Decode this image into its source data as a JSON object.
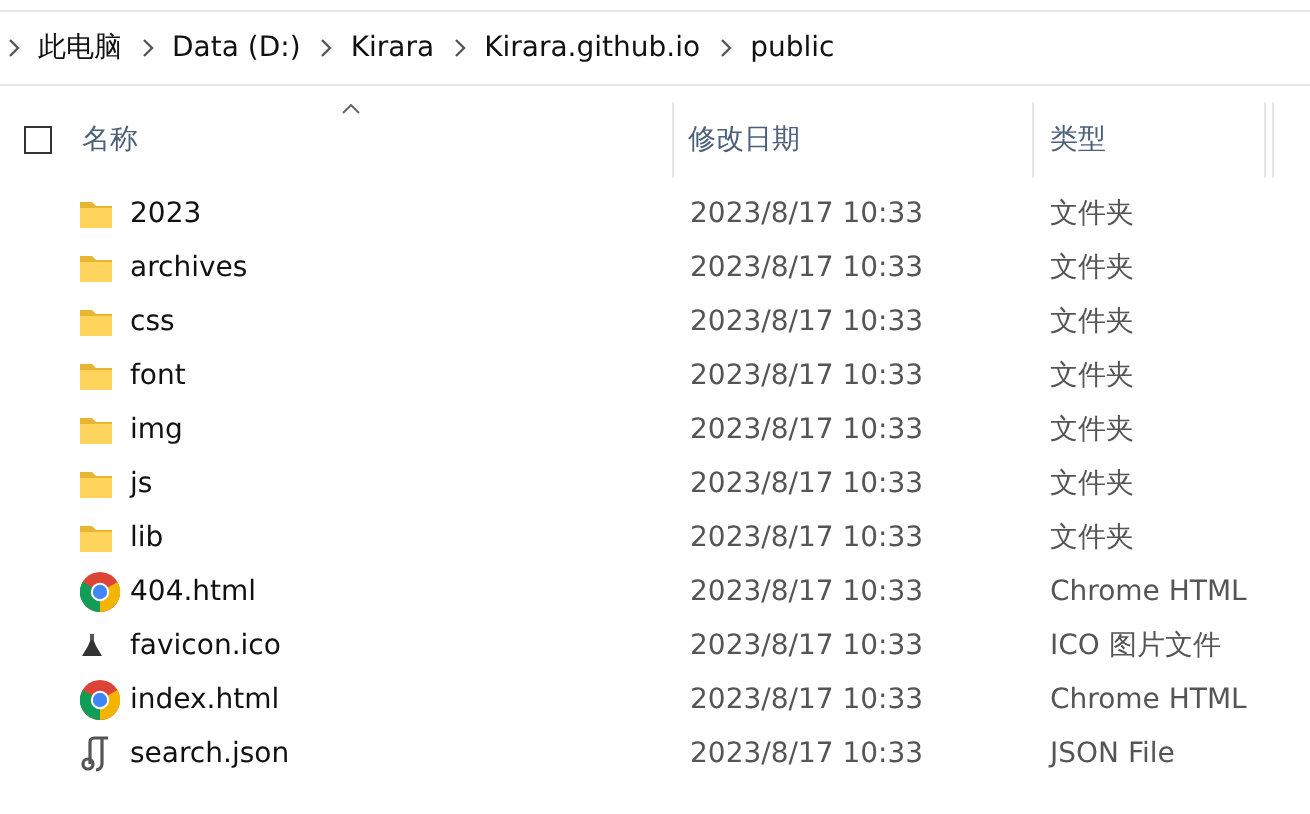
{
  "breadcrumb": [
    "此电脑",
    "Data (D:)",
    "Kirara",
    "Kirara.github.io",
    "public"
  ],
  "select_all": {
    "checked": false
  },
  "columns": [
    {
      "label": "名称",
      "sorted": true
    },
    {
      "label": "修改日期",
      "sorted": false
    },
    {
      "label": "类型",
      "sorted": false
    }
  ],
  "files": [
    {
      "name": "2023",
      "date": "2023/8/17 10:33",
      "type": "文件夹",
      "kind": "folder"
    },
    {
      "name": "archives",
      "date": "2023/8/17 10:33",
      "type": "文件夹",
      "kind": "folder"
    },
    {
      "name": "css",
      "date": "2023/8/17 10:33",
      "type": "文件夹",
      "kind": "folder"
    },
    {
      "name": "font",
      "date": "2023/8/17 10:33",
      "type": "文件夹",
      "kind": "folder"
    },
    {
      "name": "img",
      "date": "2023/8/17 10:33",
      "type": "文件夹",
      "kind": "folder"
    },
    {
      "name": "js",
      "date": "2023/8/17 10:33",
      "type": "文件夹",
      "kind": "folder"
    },
    {
      "name": "lib",
      "date": "2023/8/17 10:33",
      "type": "文件夹",
      "kind": "folder"
    },
    {
      "name": "404.html",
      "date": "2023/8/17 10:33",
      "type": "Chrome HTML",
      "kind": "chrome"
    },
    {
      "name": "favicon.ico",
      "date": "2023/8/17 10:33",
      "type": "ICO 图片文件",
      "kind": "ico"
    },
    {
      "name": "index.html",
      "date": "2023/8/17 10:33",
      "type": "Chrome HTML",
      "kind": "chrome"
    },
    {
      "name": "search.json",
      "date": "2023/8/17 10:33",
      "type": "JSON File",
      "kind": "json"
    }
  ]
}
